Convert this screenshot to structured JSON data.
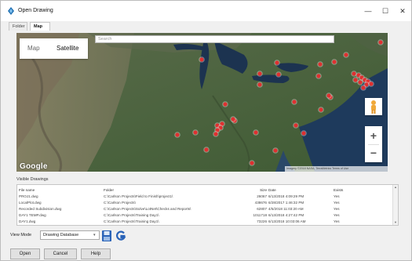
{
  "window": {
    "title": "Open Drawing",
    "controls": {
      "minimize": "—",
      "maximize": "☐",
      "close": "✕"
    }
  },
  "tabs": [
    {
      "label": "Folder"
    },
    {
      "label": "Map"
    }
  ],
  "map": {
    "search_placeholder": "Search",
    "type_buttons": {
      "map": "Map",
      "satellite": "Satellite"
    },
    "zoom_in": "+",
    "zoom_out": "−",
    "logo": "Google",
    "attribution": "Imagery ©2018 NASA, TerraMetrics   Terms of Use",
    "marker_color": "#e03030",
    "marker_count": 40
  },
  "drawings": {
    "label": "Visible Drawings",
    "columns": {
      "name": "File name",
      "folder": "Folder",
      "size": "Size",
      "date": "Date",
      "exists": "Exists"
    },
    "rows": [
      {
        "name": "PROJ1.dwg",
        "folder": "C:\\Carlson Projects\\Field to Finish\\project1\\",
        "size": "26067",
        "date": "6/13/2018 4:09:29 PM",
        "exists": "Yes"
      },
      {
        "name": "LocalPlot.dwg",
        "folder": "C:\\Carlson Projects\\",
        "size": "438676",
        "date": "6/28/2017 1:46:32 PM",
        "exists": "Yes"
      },
      {
        "name": "Recorded Subdivision.dwg",
        "folder": "C:\\Carlson Projects\\Solve\\LotNet\\Checks and Reports\\",
        "size": "62807",
        "date": "4/5/2018 11:03:20 AM",
        "exists": "Yes"
      },
      {
        "name": "DAY1 TEMP.dwg",
        "folder": "C:\\Carlson Projects\\Training Day1\\",
        "size": "1011718",
        "date": "6/13/2018 4:27:42 PM",
        "exists": "Yes"
      },
      {
        "name": "DAY1.dwg",
        "folder": "C:\\Carlson Projects\\Training Day1\\",
        "size": "73226",
        "date": "6/13/2018 10:03:06 AM",
        "exists": "Yes"
      }
    ]
  },
  "view_mode": {
    "label": "View Mode",
    "selected": "Drawing Database",
    "arrow": "▾"
  },
  "toolbar_icons": {
    "save": "save-icon",
    "refresh": "g-refresh-icon"
  },
  "buttons": {
    "open": "Open",
    "cancel": "Cancel",
    "help": "Help"
  }
}
